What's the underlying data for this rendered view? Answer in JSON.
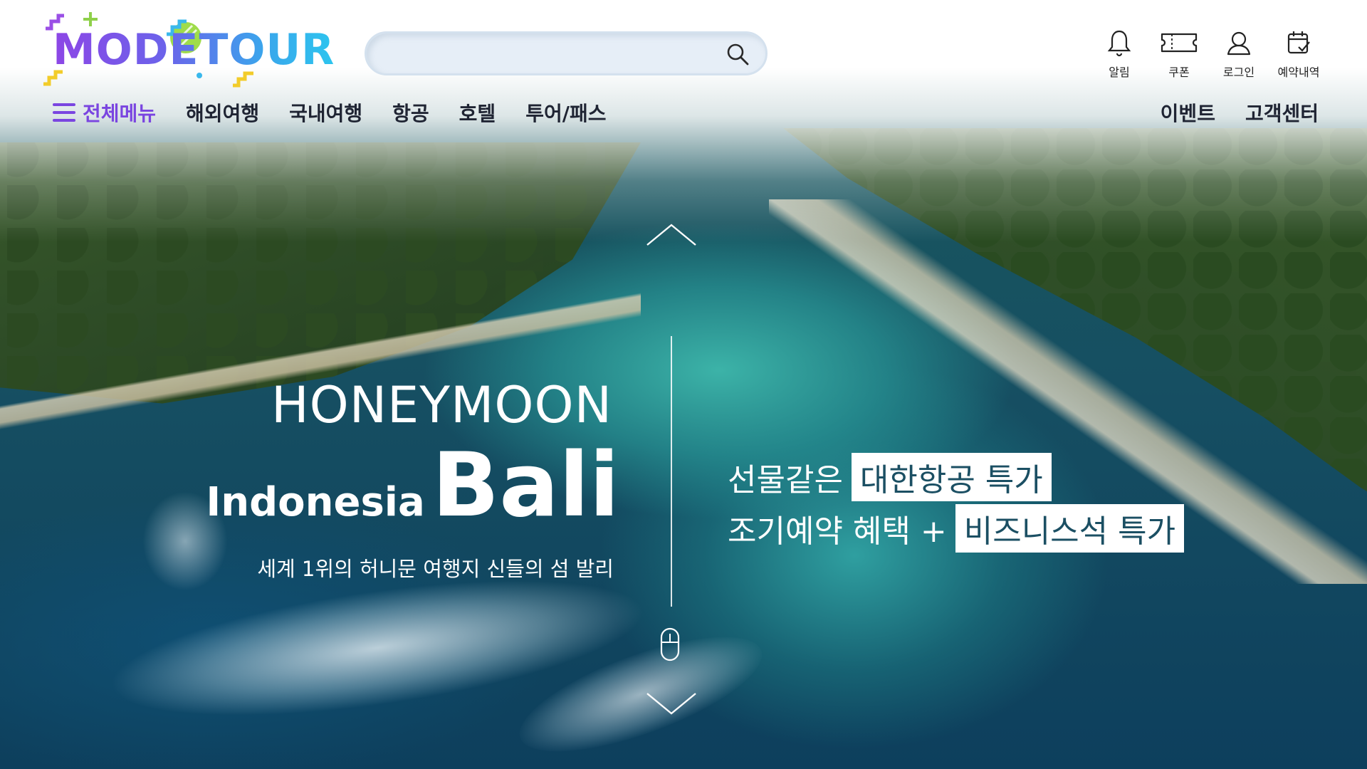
{
  "header": {
    "logo_text": "MODETOUR",
    "search": {
      "placeholder": ""
    },
    "utilities": [
      {
        "label": "알림",
        "icon": "bell-icon"
      },
      {
        "label": "쿠폰",
        "icon": "coupon-icon"
      },
      {
        "label": "로그인",
        "icon": "user-icon"
      },
      {
        "label": "예약내역",
        "icon": "calendar-check-icon"
      }
    ]
  },
  "nav": {
    "all_menu": "전체메뉴",
    "items": [
      "해외여행",
      "국내여행",
      "항공",
      "호텔",
      "투어/패스"
    ],
    "right_items": [
      "이벤트",
      "고객센터"
    ]
  },
  "hero": {
    "title": "HONEYMOON",
    "country": "Indonesia",
    "city": "Bali",
    "subtitle": "세계 1위의 허니문 여행지 신들의 섬 발리",
    "promo_line1_prefix": "선물같은",
    "promo_line1_highlight": "대한항공 특가",
    "promo_line2_prefix": "조기예약 혜택 +",
    "promo_line2_highlight": "비즈니스석 특가"
  },
  "colors": {
    "brand_purple": "#7a45e0",
    "brand_cyan": "#2dc5ee",
    "nav_text": "#1f2433"
  }
}
